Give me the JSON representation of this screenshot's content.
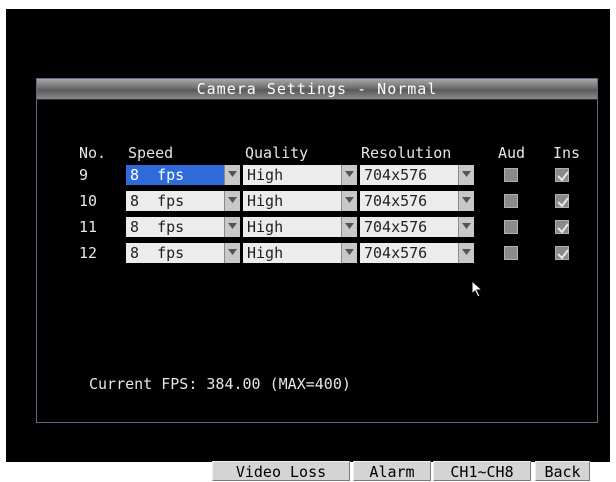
{
  "window": {
    "title": "Camera Settings - Normal"
  },
  "columns": {
    "no": "No.",
    "speed": "Speed",
    "quality": "Quality",
    "resolution": "Resolution",
    "aud": "Aud",
    "ins": "Ins"
  },
  "rows": [
    {
      "no": "9",
      "speed": "8  fps",
      "quality": "High",
      "resolution": "704x576",
      "aud": false,
      "ins": true,
      "speed_highlighted": true
    },
    {
      "no": "10",
      "speed": "8  fps",
      "quality": "High",
      "resolution": "704x576",
      "aud": false,
      "ins": true,
      "speed_highlighted": false
    },
    {
      "no": "11",
      "speed": "8  fps",
      "quality": "High",
      "resolution": "704x576",
      "aud": false,
      "ins": true,
      "speed_highlighted": false
    },
    {
      "no": "12",
      "speed": "8  fps",
      "quality": "High",
      "resolution": "704x576",
      "aud": false,
      "ins": true,
      "speed_highlighted": false
    }
  ],
  "status": {
    "current_fps": "Current FPS: 384.00 (MAX=400)"
  },
  "buttons": {
    "video_loss": "Video Loss",
    "alarm": "Alarm",
    "channels": "CH1~CH8",
    "back": "Back"
  },
  "icons": {
    "dropdown": "chevron-down-icon",
    "checked": "checkmark-icon",
    "pointer": "mouse-pointer-icon"
  },
  "colors": {
    "selected_field": "#2f6bd8",
    "window_border": "#5a6a88",
    "screen_bg": "#000000"
  }
}
